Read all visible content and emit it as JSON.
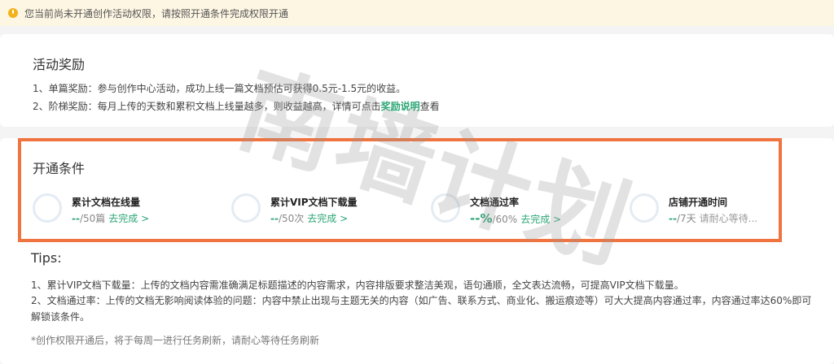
{
  "notice": {
    "text": "您当前尚未开通创作活动权限，请按照开通条件完成权限开通"
  },
  "reward": {
    "title": "活动奖励",
    "line1": "1、单篇奖励：参与创作中心活动，成功上线一篇文档预估可获得0.5元-1.5元的收益。",
    "line2_prefix": "2、阶梯奖励：每月上传的天数和累积文档上线量越多，则收益越高，详情可点击",
    "line2_link": "奖励说明",
    "line2_suffix": "查看"
  },
  "open": {
    "title": "开通条件",
    "conditions": [
      {
        "name": "累计文档在线量",
        "current": "--",
        "target": "/50篇",
        "action": "去完成 >"
      },
      {
        "name": "累计VIP文档下载量",
        "current": "--",
        "target": "/50次",
        "action": "去完成 >"
      },
      {
        "name": "文档通过率",
        "current": "--%",
        "target": "/60%",
        "action": "去完成 >"
      },
      {
        "name": "店铺开通时间",
        "current": "--",
        "target": "/7天",
        "action": "请耐心等待..."
      }
    ]
  },
  "tips": {
    "title": "Tips:",
    "tip1": "1、累计VIP文档下载量：上传的文档内容需准确满足标题描述的内容需求，内容排版要求整洁美观，语句通顺，全文表达流畅，可提高VIP文档下载量。",
    "tip2": "2、文档通过率：上传的文档无影响阅读体验的问题：内容中禁止出现与主题无关的内容（如广告、联系方式、商业化、搬运痕迹等）可大大提高内容通过率，内容通过率达60%即可解锁该条件。",
    "footnote": "*创作权限开通后，将于每周一进行任务刷新，请耐心等待任务刷新"
  },
  "watermark": "南墙计划",
  "colors": {
    "accent_green": "#2aa674",
    "highlight_border": "#f07440",
    "notice_bg": "#fdf6e3",
    "notice_icon": "#f2b21b"
  }
}
